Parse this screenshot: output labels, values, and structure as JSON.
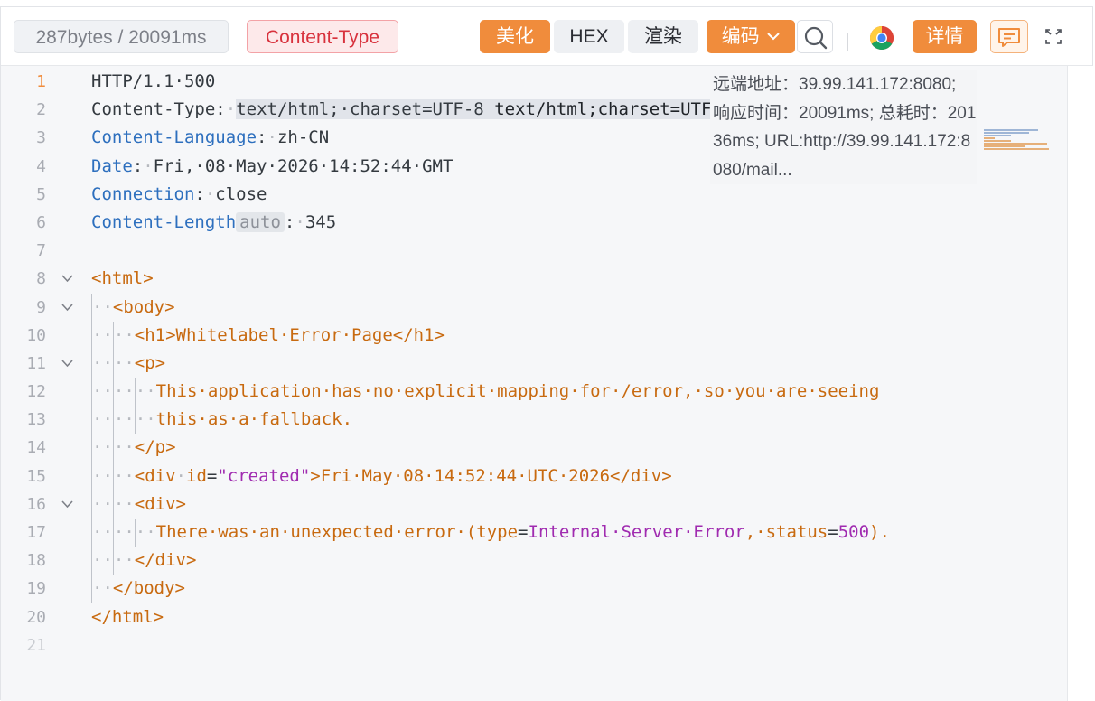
{
  "toolbar": {
    "size_info": "287bytes / 20091ms",
    "content_type_label": "Content-Type",
    "beautify_label": "美化",
    "hex_label": "HEX",
    "render_label": "渲染",
    "encode_label": "编码",
    "detail_label": "详情",
    "icons": [
      "search-icon",
      "chrome-icon",
      "comment-icon",
      "expand-icon",
      "chevron-down-icon"
    ]
  },
  "colors": {
    "accent_orange": "#f08c3c",
    "keyword_blue": "#2d6fbe",
    "tag_orange": "#c86a10",
    "string_purple": "#a02bb0",
    "content_type_red": "#d8323d"
  },
  "overlay": {
    "text": "远端地址：39.99.141.172:8080; 响应时间：20091ms; 总耗时：20136ms; URL:http://39.99.141.172:8080/mail..."
  },
  "editor": {
    "active_line": 1,
    "line_numbers": [
      "1",
      "2",
      "3",
      "4",
      "5",
      "6",
      "7",
      "8",
      "9",
      "10",
      "11",
      "12",
      "13",
      "14",
      "15",
      "16",
      "17",
      "18",
      "19",
      "20",
      "21"
    ],
    "folded_lines": [
      8,
      9,
      11,
      16
    ],
    "status_line": "HTTP/1.1·500",
    "headers": {
      "ct_key": "Content-Type",
      "ct_value": "text/html;·charset=UTF-8",
      "ct_hint": "text/html;charset=UTF-8",
      "lang_key": "Content-Language",
      "lang_value": "zh-CN",
      "date_key": "Date",
      "date_value": "Fri,·08·May·2026·14:52:44·GMT",
      "conn_key": "Connection",
      "conn_value": "close",
      "len_key": "Content-Length",
      "len_badge": "auto",
      "len_value": "345"
    },
    "body": {
      "html_open": "<html>",
      "body_open": "<body>",
      "h1_open": "<h1>",
      "h1_text": "Whitelabel·Error·Page",
      "h1_close": "</h1>",
      "p_open": "<p>",
      "p_text_1": "This·application·has·no·explicit·mapping·for·/error,·so·you·are·seeing",
      "p_text_2": "this·as·a·fallback.",
      "p_close": "</p>",
      "div_open_start": "<div",
      "div_attr": "id",
      "div_attr_value": "\"created\"",
      "div_tag_end": ">",
      "div_text": "Fri·May·08·14:52:44·UTC·2026",
      "div_close": "</div>",
      "div2_open": "<div>",
      "err_text_1": "There·was·an·unexpected·error·(type",
      "err_type": "Internal·Server·Error",
      "err_text_2": ",·status",
      "err_status": "500",
      "err_text_3": ").",
      "div2_close": "</div>",
      "body_close": "</body>",
      "html_close": "</html>"
    }
  }
}
